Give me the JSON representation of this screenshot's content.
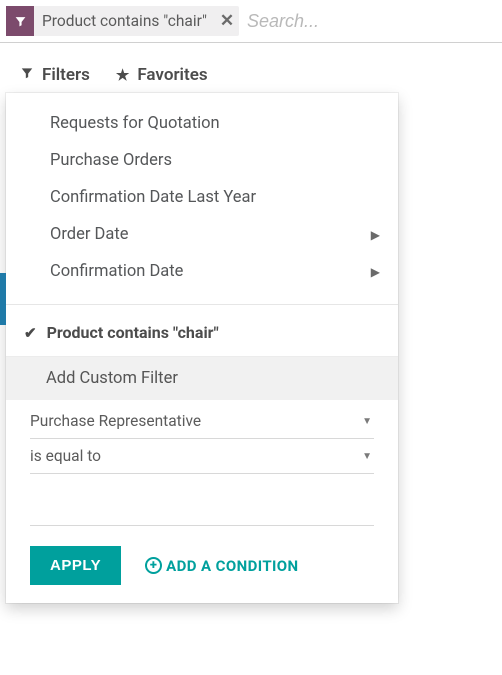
{
  "search": {
    "facet_label": "Product contains \"chair\"",
    "placeholder": "Search..."
  },
  "toolbar": {
    "filters_label": "Filters",
    "favorites_label": "Favorites"
  },
  "menu": {
    "items": [
      {
        "label": "Requests for Quotation",
        "submenu": false
      },
      {
        "label": "Purchase Orders",
        "submenu": false
      },
      {
        "label": "Confirmation Date Last Year",
        "submenu": false
      },
      {
        "label": "Order Date",
        "submenu": true
      },
      {
        "label": "Confirmation Date",
        "submenu": true
      }
    ],
    "active_filter_label": "Product contains \"chair\""
  },
  "custom": {
    "header": "Add Custom Filter",
    "field": "Purchase Representative",
    "operator": "is equal to",
    "value": "",
    "apply_label": "APPLY",
    "add_condition_label": "ADD A CONDITION"
  }
}
